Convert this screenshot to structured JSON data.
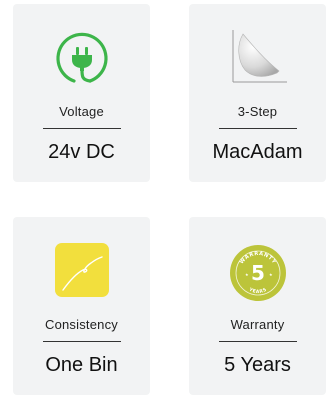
{
  "features": [
    {
      "icon": "power-plug-icon",
      "label": "Voltage",
      "value": "24v DC"
    },
    {
      "icon": "macadam-chart-icon",
      "label": "3-Step",
      "value": "MacAdam"
    },
    {
      "icon": "color-curve-icon",
      "label": "Consistency",
      "value": "One Bin"
    },
    {
      "icon": "warranty-badge-icon",
      "label": "Warranty",
      "value": "5 Years",
      "badge": {
        "top_text": "WARRANTY",
        "number": "5",
        "bottom_text": "YEARS"
      }
    }
  ],
  "colors": {
    "card_bg": "#f2f3f4",
    "plug_green": "#3db54a",
    "consistency_yellow": "#f2df3d",
    "warranty_olive": "#bcc43a"
  }
}
